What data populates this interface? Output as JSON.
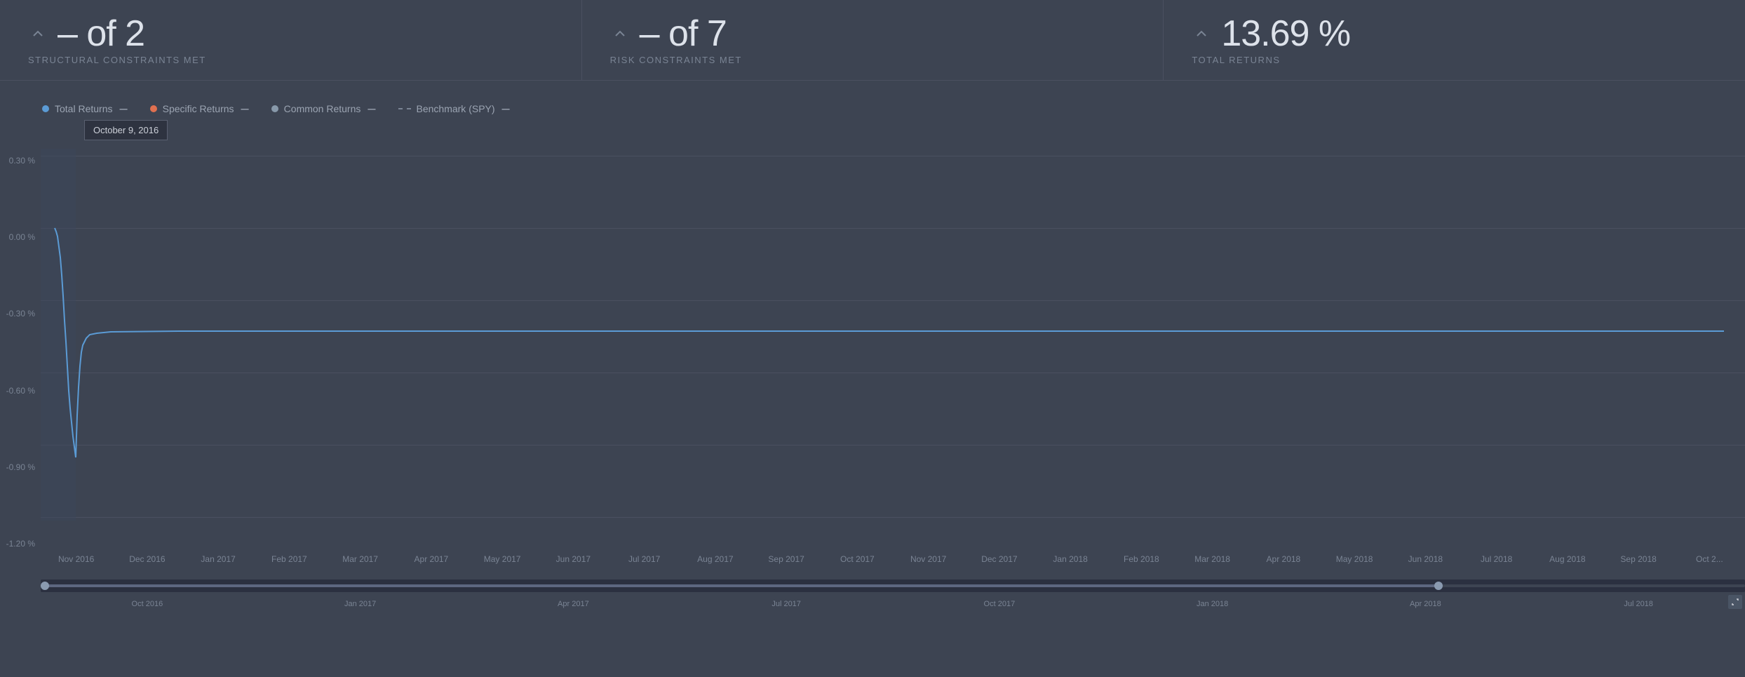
{
  "metrics": [
    {
      "id": "structural",
      "value": "– of 2",
      "label": "STRUCTURAL CONSTRAINTS MET"
    },
    {
      "id": "risk",
      "value": "– of 7",
      "label": "RISK CONSTRAINTS MET"
    },
    {
      "id": "returns",
      "value": "13.69 %",
      "label": "TOTAL RETURNS"
    }
  ],
  "legend": {
    "items": [
      {
        "id": "total-returns",
        "label": "Total Returns",
        "color": "#5b9bd5",
        "type": "dot"
      },
      {
        "id": "specific-returns",
        "label": "Specific Returns",
        "color": "#e07050",
        "type": "dot"
      },
      {
        "id": "common-returns",
        "label": "Common Returns",
        "color": "#8899aa",
        "type": "dot"
      },
      {
        "id": "benchmark",
        "label": "Benchmark (SPY)",
        "color": "#7a8494",
        "type": "dashed"
      }
    ]
  },
  "tooltip": {
    "date": "October 9, 2016"
  },
  "yAxis": {
    "labels": [
      "0.30 %",
      "0.00 %",
      "-0.30 %",
      "-0.60 %",
      "-0.90 %",
      "-1.20 %"
    ]
  },
  "xAxis": {
    "labels": [
      "Nov 2016",
      "Dec 2016",
      "Jan 2017",
      "Feb 2017",
      "Mar 2017",
      "Apr 2017",
      "May 2017",
      "Jun 2017",
      "Jul 2017",
      "Aug 2017",
      "Sep 2017",
      "Oct 2017",
      "Nov 2017",
      "Dec 2017",
      "Jan 2018",
      "Feb 2018",
      "Mar 2018",
      "Apr 2018",
      "May 2018",
      "Jun 2018",
      "Jul 2018",
      "Aug 2018",
      "Sep 2018",
      "Oct 2..."
    ]
  },
  "rangeBar": {
    "labels": [
      "Oct 2016",
      "Jan 2017",
      "Apr 2017",
      "Jul 2017",
      "Oct 2017",
      "Jan 2018",
      "Apr 2018",
      "Jul 2018"
    ]
  },
  "chart": {
    "highlightX": 52,
    "highlightWidth": 38
  }
}
